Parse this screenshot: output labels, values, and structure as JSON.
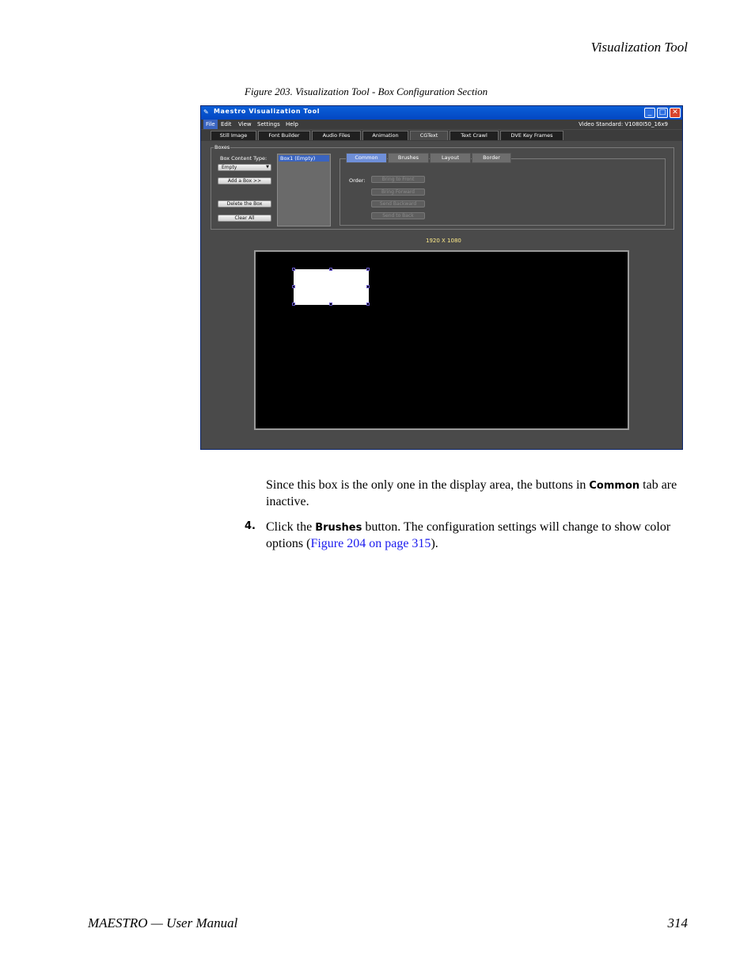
{
  "header": {
    "section_title": "Visualization Tool"
  },
  "figure": {
    "caption": "Figure 203.  Visualization Tool - Box Configuration Section",
    "window": {
      "title": "Maestro Visualization Tool",
      "controls": {
        "minimize": "_",
        "maximize": "□",
        "close": "✕"
      },
      "menu": [
        "File",
        "Edit",
        "View",
        "Settings",
        "Help"
      ],
      "video_standard": "Video Standard: V1080I50_16x9",
      "tabs": [
        "Still Image",
        "Font Builder",
        "Audio Files",
        "Animation",
        "CGText",
        "Text Crawl",
        "DVE Key Frames"
      ],
      "active_tab": "CGText",
      "boxes_group": {
        "label": "Boxes",
        "box_content_type_label": "Box Content Type:",
        "content_type_value": "Empty",
        "add_box_button": "Add a Box >>",
        "delete_box_button": "Delete the Box",
        "clear_all_button": "Clear All",
        "list_items": [
          "Box1 (Empty)"
        ]
      },
      "config_tabs": [
        "Common",
        "Brushes",
        "Layout",
        "Border"
      ],
      "active_config_tab": "Common",
      "order_label": "Order:",
      "order_buttons": [
        "Bring to Front",
        "Bring Forward",
        "Send Backward",
        "Send to Back"
      ],
      "resolution_label": "1920 X 1080"
    }
  },
  "body": {
    "para1_part1": "Since this box is the only one in the display area, the buttons in ",
    "para1_button": "Common",
    "para1_part2": " tab are inactive.",
    "step_number": "4.",
    "step_part1": "Click the ",
    "step_button": "Brushes",
    "step_part2": " button. The configuration settings will change to show color options (",
    "step_link": "Figure 204 on page 315",
    "step_part3": ")."
  },
  "footer": {
    "left": "MAESTRO  —  User Manual",
    "page_number": "314"
  }
}
